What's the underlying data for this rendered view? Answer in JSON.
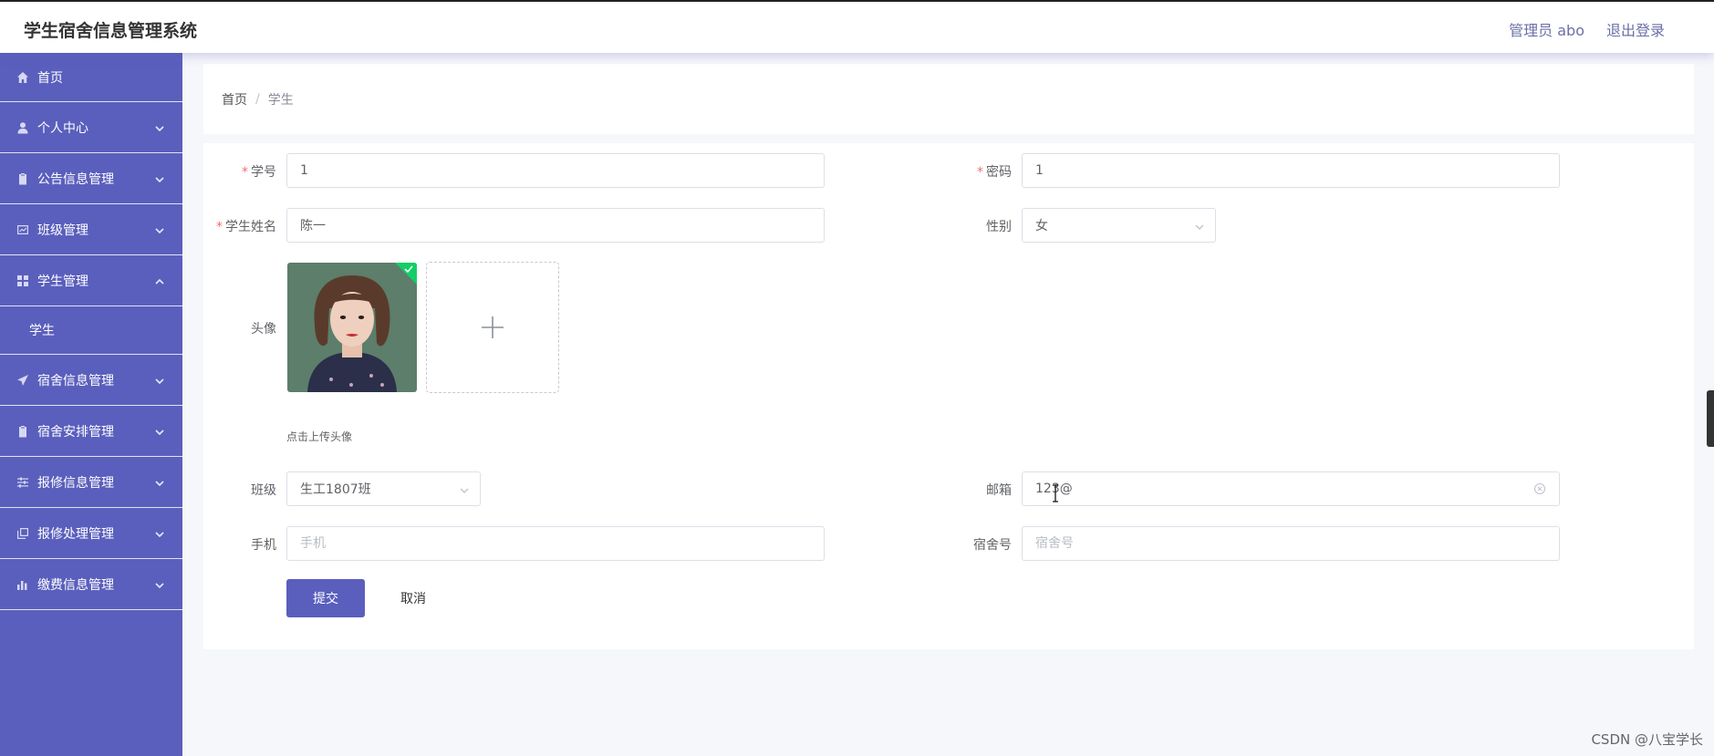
{
  "header": {
    "app_title": "学生宿舍信息管理系统",
    "user_label": "管理员 abo",
    "logout_label": "退出登录"
  },
  "sidebar": {
    "items": [
      {
        "label": "首页",
        "icon": "home-icon"
      },
      {
        "label": "个人中心",
        "icon": "user-icon"
      },
      {
        "label": "公告信息管理",
        "icon": "clipboard-icon"
      },
      {
        "label": "班级管理",
        "icon": "chart-box-icon"
      },
      {
        "label": "学生管理",
        "icon": "grid-icon",
        "expanded": true
      },
      {
        "label": "宿舍信息管理",
        "icon": "send-icon"
      },
      {
        "label": "宿舍安排管理",
        "icon": "clipboard-icon"
      },
      {
        "label": "报修信息管理",
        "icon": "sliders-icon"
      },
      {
        "label": "报修处理管理",
        "icon": "copy-icon"
      },
      {
        "label": "缴费信息管理",
        "icon": "bar-chart-icon"
      }
    ],
    "subitems": [
      {
        "label": "学生"
      }
    ]
  },
  "breadcrumb": {
    "home": "首页",
    "separator": "/",
    "current": "学生"
  },
  "form": {
    "student_id": {
      "label": "学号",
      "required": true,
      "value": "1"
    },
    "password": {
      "label": "密码",
      "required": true,
      "value": "1"
    },
    "student_name": {
      "label": "学生姓名",
      "required": true,
      "value": "陈一"
    },
    "gender": {
      "label": "性别",
      "value": "女"
    },
    "avatar": {
      "label": "头像",
      "hint": "点击上传头像"
    },
    "class": {
      "label": "班级",
      "value": "生工1807班"
    },
    "email": {
      "label": "邮箱",
      "value": "123@"
    },
    "phone": {
      "label": "手机",
      "value": "",
      "placeholder": "手机"
    },
    "dorm_no": {
      "label": "宿舍号",
      "value": "",
      "placeholder": "宿舍号"
    },
    "submit_label": "提交",
    "cancel_label": "取消",
    "required_mark": "*"
  },
  "watermark": "CSDN @八宝学长",
  "colors": {
    "accent": "#5a5fbd",
    "required": "#f56c6c",
    "upload_success": "#13ce66"
  }
}
